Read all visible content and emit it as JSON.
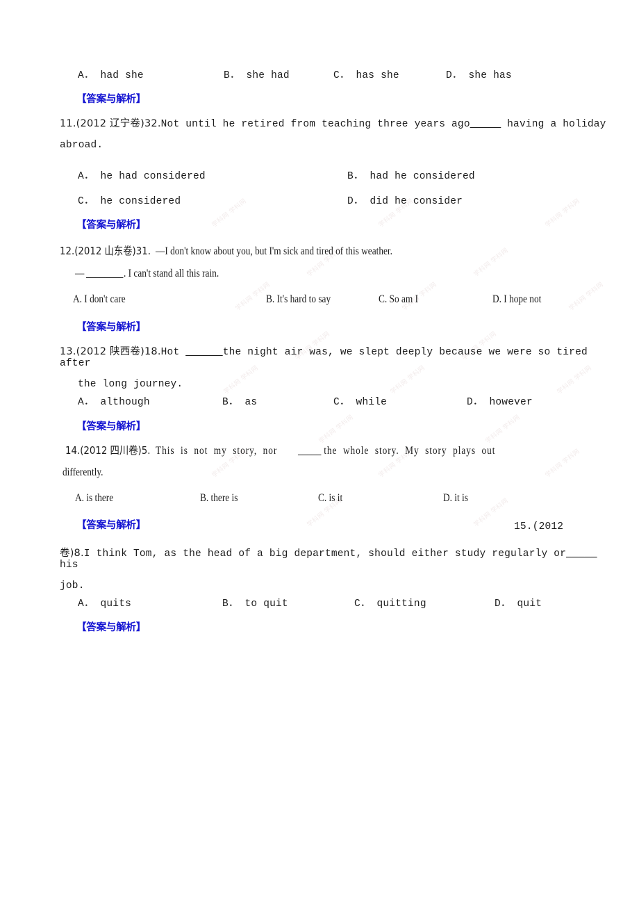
{
  "document": {
    "answer_tag": "【答案与解析】",
    "accent_color": "#1414d2",
    "text_color": "#1c1c1c",
    "page_background": "#ffffff"
  },
  "q10_options": {
    "a": "A． had she",
    "b": "B． she had",
    "c": "C． has she",
    "d": "D． she has"
  },
  "answer_tag_1": "【答案与解析】",
  "q11": {
    "prefix": "11.(2012 辽宁卷)32.",
    "stem_line1": "Not until he retired from teaching three years ago",
    "stem_blank": "_____",
    "stem_line1_tail": " having a holiday",
    "stem_line2": "abroad.",
    "options": {
      "a": "A． he had considered",
      "b": "B． had he considered",
      "c": "C． he considered",
      "d": "D． did he consider"
    },
    "answer_tag": "【答案与解析】"
  },
  "q12": {
    "prefix": "12.(2012 山东卷)31.",
    "stem_line1": "—I don't know about you, but I'm sick and tired of this weather.",
    "stem_line2_lead": "— ",
    "stem_line2_blank": "________",
    "stem_line2_tail": ". I can't stand all this rain.",
    "options": {
      "a": "A. I don't care",
      "b": "B. It's hard to say",
      "c": "C. So am I",
      "d": "D. I hope not"
    },
    "answer_tag": "【答案与解析】"
  },
  "q13": {
    "prefix": "13.(2012 陕西卷)18.",
    "stem_line1_head": "Hot ",
    "stem_blank": "______",
    "stem_line1_tail": "the night air was, we slept deeply because we were so tired after",
    "stem_line2": "the long journey.",
    "options": {
      "a": "A． although",
      "b": "B． as",
      "c": "C． while",
      "d": "D． however"
    },
    "answer_tag": "【答案与解析】"
  },
  "q14": {
    "prefix": "14.(2012 四川卷)5.",
    "stem_line1_head": "This  is  not  my  story,  nor ",
    "stem_blank": "_____",
    "stem_line1_tail": " the  whole  story.  My  story  plays  out",
    "stem_line2": "differently.",
    "options": {
      "a": "A. is there",
      "b": "B. there is",
      "c": "C. is it",
      "d": "D. it is"
    },
    "answer_tag": "【答案与解析】"
  },
  "q15": {
    "prefix_right": "15.(2012",
    "prefix_cont": "卷)8.",
    "stem_line1": "I think Tom, as the head of a big department, should either study regularly or",
    "stem_blank": "_____",
    "stem_line1_tail": " his",
    "stem_line2": "job.",
    "options": {
      "a": "A． quits",
      "b": "B． to quit",
      "c": "C． quitting",
      "d": "D． quit"
    },
    "answer_tag": "【答案与解析】"
  },
  "watermark": {
    "text": "学科网"
  }
}
